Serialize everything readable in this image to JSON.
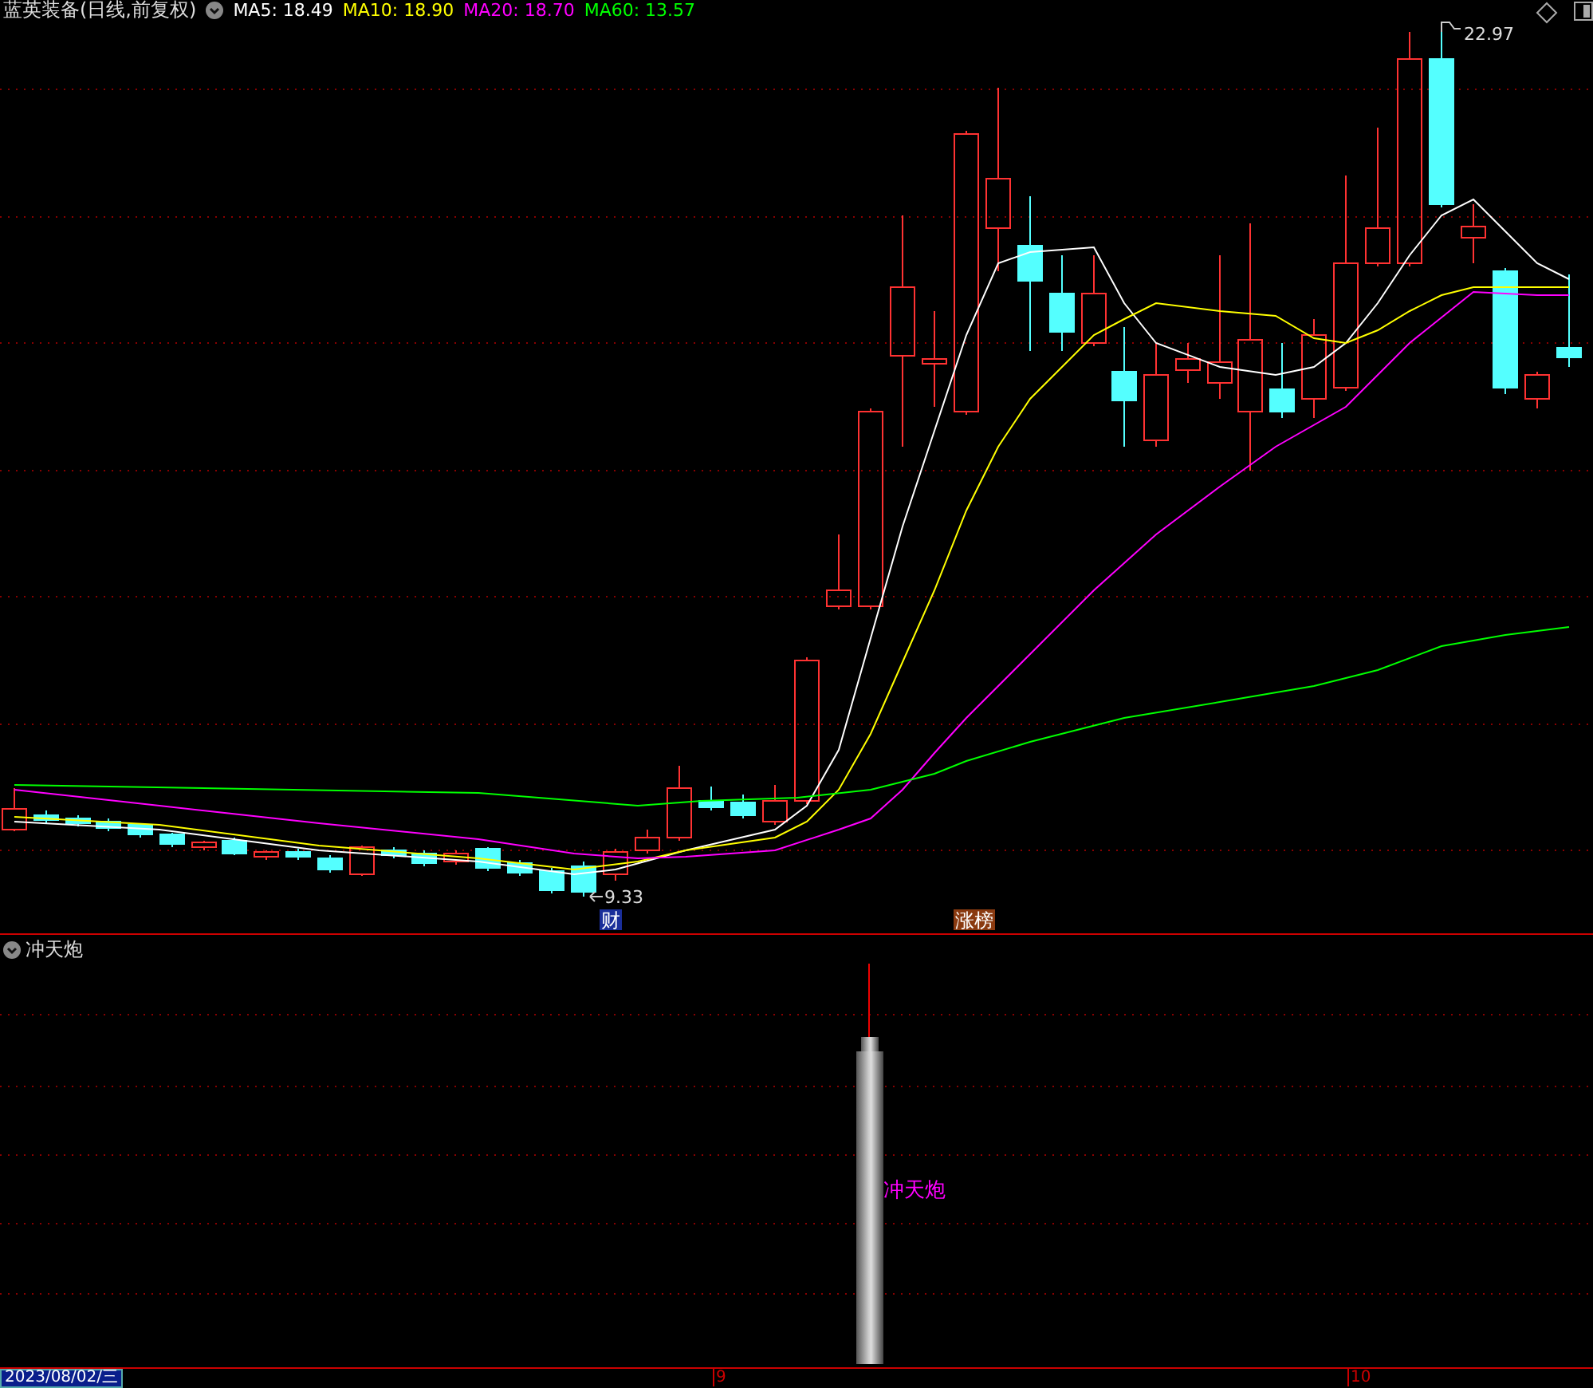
{
  "header": {
    "stock": "蓝英装备(日线,前复权)",
    "indicators": [
      {
        "label": "MA5: 18.49",
        "color": "#ffffff"
      },
      {
        "label": "MA10: 18.90",
        "color": "#ffff00"
      },
      {
        "label": "MA20: 18.70",
        "color": "#ff00ff"
      },
      {
        "label": "MA60: 13.57",
        "color": "#00ff00"
      }
    ]
  },
  "main_chart": {
    "high_label": "22.97",
    "low_label": "9.33",
    "markers": [
      {
        "text": "财",
        "kind": "finance"
      },
      {
        "text": "涨榜",
        "kind": "rank"
      }
    ]
  },
  "sub_chart": {
    "title": "冲天炮",
    "signal_label": "冲天炮"
  },
  "time_axis": {
    "date": "2023/08/02/三",
    "ticks": [
      "9",
      "10"
    ]
  }
}
